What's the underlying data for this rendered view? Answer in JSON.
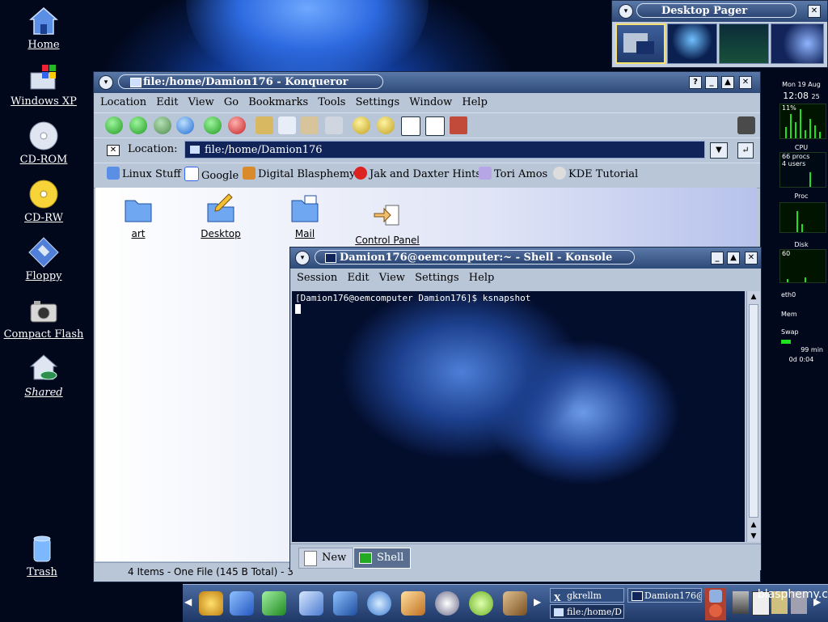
{
  "desktop": {
    "icons": [
      {
        "label": "Home"
      },
      {
        "label": "Windows XP"
      },
      {
        "label": "CD-ROM"
      },
      {
        "label": "CD-RW"
      },
      {
        "label": "Floppy"
      },
      {
        "label": "Compact Flash"
      },
      {
        "label": "Shared"
      },
      {
        "label": "Trash"
      }
    ]
  },
  "pager": {
    "title": "Desktop Pager",
    "icons": [
      "pager-menu-icon",
      "close-icon"
    ]
  },
  "konqueror": {
    "title": "file:/home/Damion176 - Konqueror",
    "menu": [
      "Location",
      "Edit",
      "View",
      "Go",
      "Bookmarks",
      "Tools",
      "Settings",
      "Window",
      "Help"
    ],
    "location_label": "Location:",
    "location_value": "file:/home/Damion176",
    "bookmarks": [
      "Linux Stuff",
      "Google",
      "Digital Blasphemy",
      "Jak and Daxter Hints",
      "Tori Amos",
      "KDE Tutorial"
    ],
    "files": [
      {
        "label": "art"
      },
      {
        "label": "Desktop"
      },
      {
        "label": "Mail"
      },
      {
        "label": "Control Panel"
      }
    ],
    "status": "4 Items - One File (145 B Total) - 3"
  },
  "konsole": {
    "title": "Damion176@oemcomputer:~ - Shell - Konsole",
    "menu": [
      "Session",
      "Edit",
      "View",
      "Settings",
      "Help"
    ],
    "prompt_line": "[Damion176@oemcomputer Damion176]$ ksnapshot",
    "tabs": {
      "new": "New",
      "shell": "Shell"
    }
  },
  "gkrellm": {
    "date": "Mon 19 Aug",
    "time": "12:08",
    "seconds": "25",
    "cpu_percent": "11%",
    "cpu_label": "CPU",
    "procs": "66 procs",
    "users": "4 users",
    "proc_label": "Proc",
    "disk_label": "Disk",
    "disk_value": "60",
    "eth": "eth0",
    "mem": "Mem",
    "swap": "Swap",
    "uptime_min": "99 min",
    "uptime": "0d 0:04"
  },
  "taskbar": {
    "tasks": [
      {
        "label": "gkrellm"
      },
      {
        "label": "Damion176@"
      },
      {
        "label": "file:/home/D"
      }
    ],
    "tray_text": "blasphemy.c"
  }
}
